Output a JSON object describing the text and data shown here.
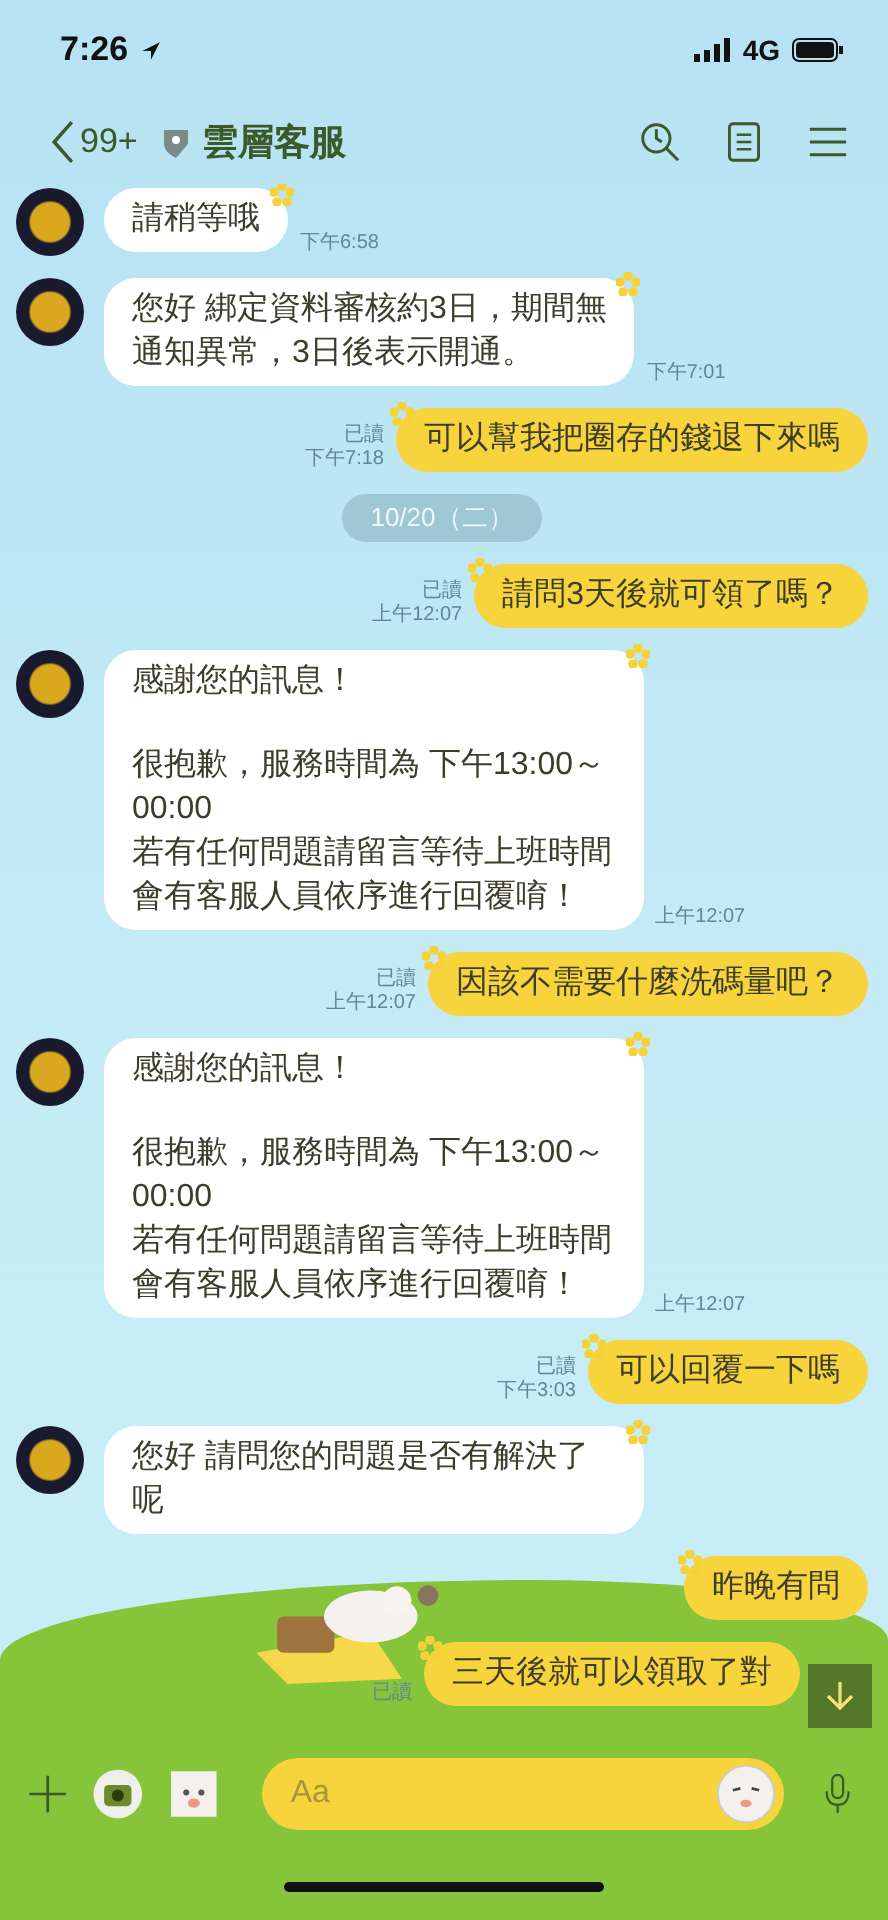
{
  "status_bar": {
    "time": "7:26",
    "network": "4G"
  },
  "header": {
    "back_count": "99+",
    "title": "雲層客服"
  },
  "messages": [
    {
      "kind": "incoming",
      "paragraphs": [
        {
          "lines": [
            "請稍等哦"
          ]
        }
      ],
      "time": "下午6:58"
    },
    {
      "kind": "incoming",
      "paragraphs": [
        {
          "lines": [
            "您好 綁定資料審核約3日，期間無",
            "通知異常，3日後表示開通。"
          ]
        }
      ],
      "time": "下午7:01"
    },
    {
      "kind": "outgoing",
      "paragraphs": [
        {
          "lines": [
            "可以幫我把圈存的錢退下來嗎"
          ]
        }
      ],
      "read": "已讀",
      "time": "下午7:18"
    },
    {
      "kind": "date",
      "text": "10/20（二）"
    },
    {
      "kind": "outgoing",
      "paragraphs": [
        {
          "lines": [
            "請問3天後就可領了嗎？"
          ]
        }
      ],
      "read": "已讀",
      "time": "上午12:07"
    },
    {
      "kind": "incoming",
      "paragraphs": [
        {
          "lines": [
            "感謝您的訊息！"
          ]
        },
        {
          "lines": [
            "很抱歉，服務時間為 下午13:00～00:00",
            "若有任何問題請留言等待上班時間",
            "會有客服人員依序進行回覆唷！"
          ]
        }
      ],
      "time": "上午12:07"
    },
    {
      "kind": "outgoing",
      "paragraphs": [
        {
          "lines": [
            "因該不需要什麼洗碼量吧？"
          ]
        }
      ],
      "read": "已讀",
      "time": "上午12:07"
    },
    {
      "kind": "incoming",
      "paragraphs": [
        {
          "lines": [
            "感謝您的訊息！"
          ]
        },
        {
          "lines": [
            "很抱歉，服務時間為 下午13:00～00:00",
            "若有任何問題請留言等待上班時間",
            "會有客服人員依序進行回覆唷！"
          ]
        }
      ],
      "time": "上午12:07"
    },
    {
      "kind": "outgoing",
      "paragraphs": [
        {
          "lines": [
            "可以回覆一下嗎"
          ]
        }
      ],
      "read": "已讀",
      "time": "下午3:03"
    },
    {
      "kind": "incoming",
      "paragraphs": [
        {
          "lines": [
            "您好 請問您的問題是否有解決了呢"
          ]
        }
      ]
    },
    {
      "kind": "outgoing",
      "paragraphs": [
        {
          "lines": [
            "昨晚有問"
          ]
        }
      ]
    },
    {
      "kind": "outgoing",
      "paragraphs": [
        {
          "lines": [
            "三天後就可以領取了對"
          ]
        }
      ],
      "read": "已讀"
    }
  ],
  "composer": {
    "placeholder": "Aa"
  }
}
